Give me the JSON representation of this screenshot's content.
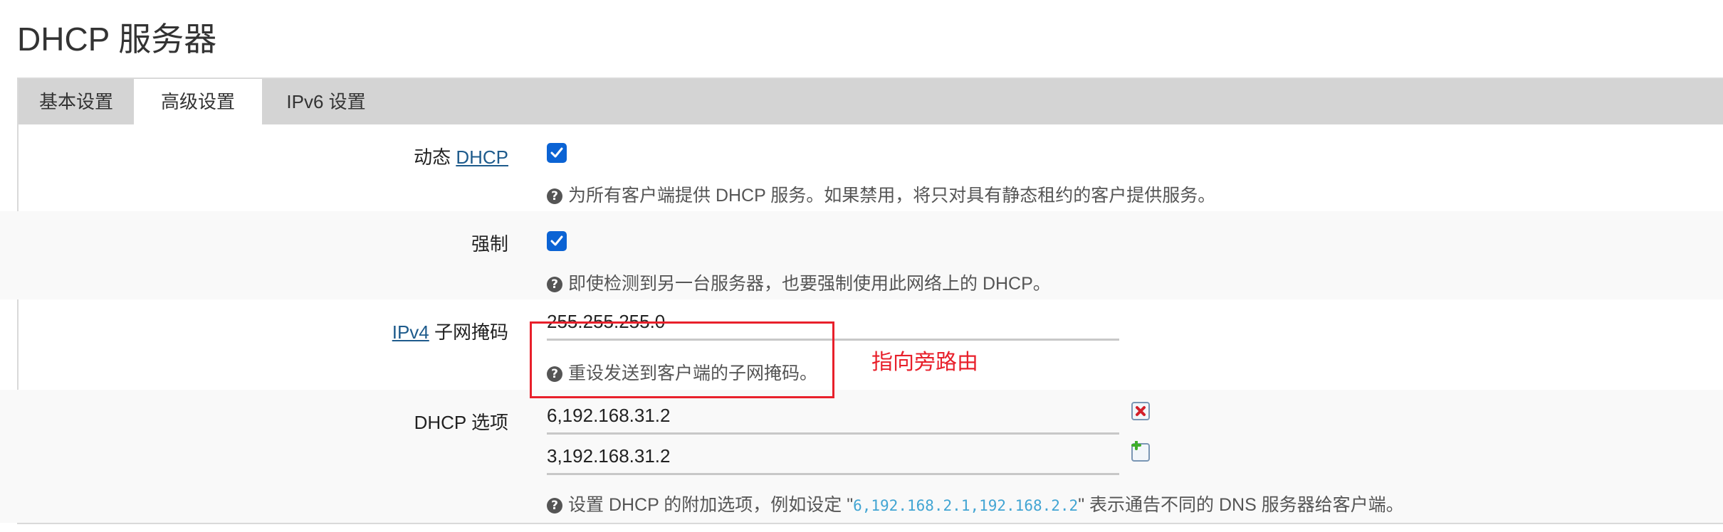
{
  "page_title": "DHCP 服务器",
  "tabs": [
    {
      "label": "基本设置",
      "active": false
    },
    {
      "label": "高级设置",
      "active": true
    },
    {
      "label": "IPv6 设置",
      "active": false
    }
  ],
  "fields": {
    "dynamic_dhcp": {
      "label_prefix": "动态 ",
      "label_link": "DHCP",
      "checked": true,
      "help": "为所有客户端提供 DHCP 服务。如果禁用，将只对具有静态租约的客户提供服务。"
    },
    "force": {
      "label": "强制",
      "checked": true,
      "help": "即使检测到另一台服务器，也要强制使用此网络上的 DHCP。"
    },
    "netmask": {
      "label_link": "IPv4",
      "label_suffix": " 子网掩码",
      "value": "255.255.255.0",
      "help": "重设发送到客户端的子网掩码。"
    },
    "dhcp_options": {
      "label": "DHCP 选项",
      "values": [
        "6,192.168.31.2",
        "3,192.168.31.2"
      ],
      "help_prefix": "设置 DHCP 的附加选项，例如设定 \"",
      "help_code": "6,192.168.2.1,192.168.2.2",
      "help_suffix": "\" 表示通告不同的 DNS 服务器给客户端。"
    }
  },
  "annotation": {
    "text": "指向旁路由",
    "color": "#e8202b"
  },
  "colors": {
    "checkbox": "#0b63d4",
    "tabbar": "#d4d4d4",
    "link": "#1e5b8c",
    "code": "#42a5d3"
  }
}
